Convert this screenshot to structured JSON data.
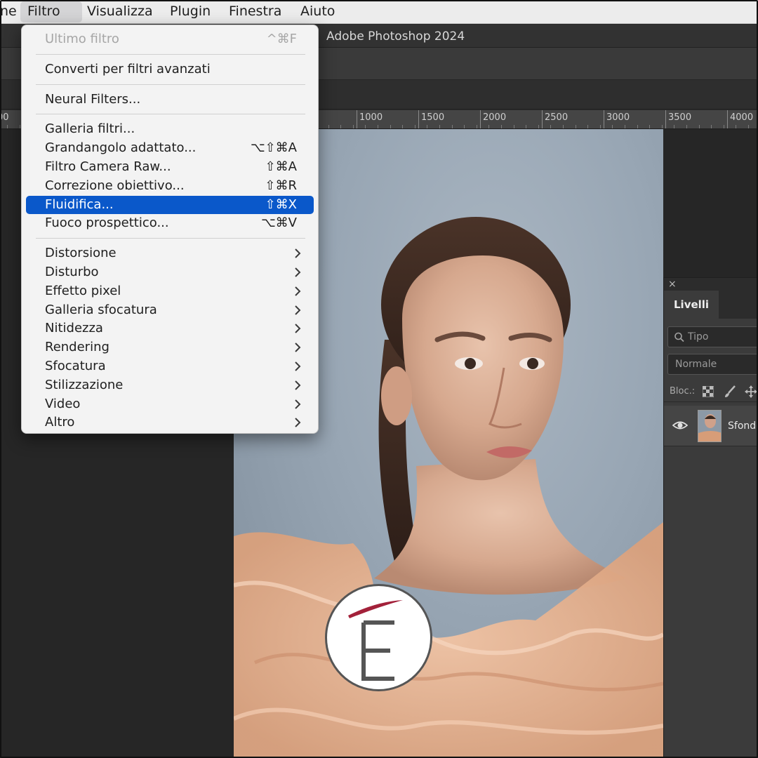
{
  "menubar": {
    "items": [
      "ne",
      "Filtro",
      "Visualizza",
      "Plugin",
      "Finestra",
      "Aiuto"
    ],
    "active_index": 1
  },
  "window": {
    "title": "Adobe Photoshop 2024"
  },
  "ruler": {
    "ticks": [
      "00",
      "1000",
      "1500",
      "2000",
      "2500",
      "3000",
      "3500",
      "4000"
    ]
  },
  "filter_menu": {
    "groups": [
      [
        {
          "label": "Ultimo filtro",
          "shortcut": "^⌘F",
          "disabled": true
        }
      ],
      [
        {
          "label": "Converti per filtri avanzati"
        }
      ],
      [
        {
          "label": "Neural Filters..."
        }
      ],
      [
        {
          "label": "Galleria filtri..."
        },
        {
          "label": "Grandangolo adattato...",
          "shortcut": "⌥⇧⌘A"
        },
        {
          "label": "Filtro Camera Raw...",
          "shortcut": "⇧⌘A"
        },
        {
          "label": "Correzione obiettivo...",
          "shortcut": "⇧⌘R"
        },
        {
          "label": "Fluidifica...",
          "shortcut": "⇧⌘X",
          "highlighted": true
        },
        {
          "label": "Fuoco prospettico...",
          "shortcut": "⌥⌘V"
        }
      ],
      [
        {
          "label": "Distorsione",
          "submenu": true
        },
        {
          "label": "Disturbo",
          "submenu": true
        },
        {
          "label": "Effetto pixel",
          "submenu": true
        },
        {
          "label": "Galleria sfocatura",
          "submenu": true
        },
        {
          "label": "Nitidezza",
          "submenu": true
        },
        {
          "label": "Rendering",
          "submenu": true
        },
        {
          "label": "Sfocatura",
          "submenu": true
        },
        {
          "label": "Stilizzazione",
          "submenu": true
        },
        {
          "label": "Video",
          "submenu": true
        },
        {
          "label": "Altro",
          "submenu": true
        }
      ]
    ]
  },
  "layers_panel": {
    "close": "×",
    "tab": "Livelli",
    "search_placeholder": "Tipo",
    "blend_mode": "Normale",
    "lock_label": "Bloc.:",
    "layer_name": "Sfondo"
  },
  "colors": {
    "menu_highlight": "#0a58ca",
    "logo_accent": "#a3213a",
    "logo_letter": "#555555"
  }
}
